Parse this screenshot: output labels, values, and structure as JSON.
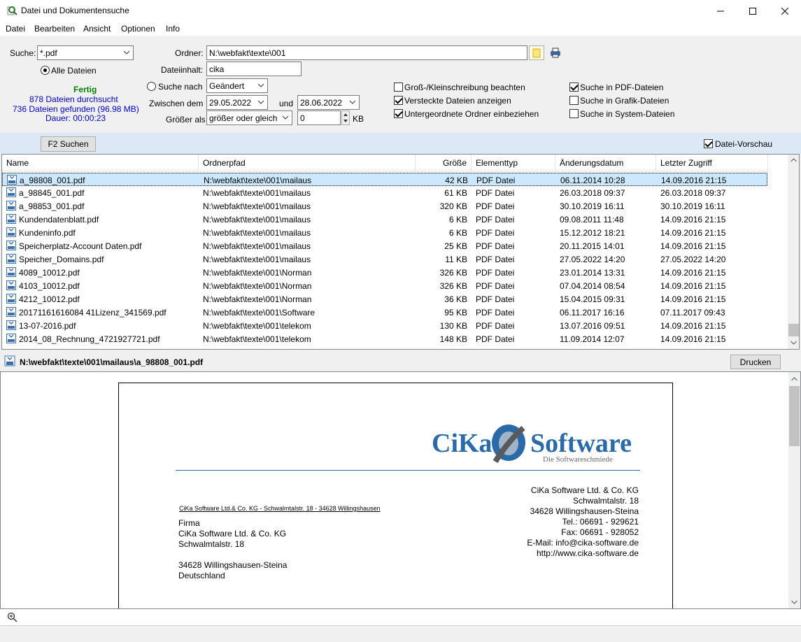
{
  "window": {
    "title": "Datei und Dokumentensuche"
  },
  "menu": [
    "Datei",
    "Bearbeiten",
    "Ansicht",
    "Optionen",
    "Info"
  ],
  "search": {
    "suche_label": "Suche:",
    "suche_value": "*.pdf",
    "alle_dateien_label": "Alle Dateien",
    "ordner_label": "Ordner:",
    "ordner_value": "N:\\webfakt\\texte\\001",
    "dateiinhalt_label": "Dateiinhalt:",
    "dateiinhalt_value": "cika",
    "suche_nach_label": "Suche nach",
    "suche_nach_value": "Geändert",
    "zwischen_label": "Zwischen dem",
    "date_from": "29.05.2022",
    "und_label": "und",
    "date_to": "28.06.2022",
    "groesser_label": "Größer als",
    "groesser_value": "größer oder gleich",
    "size_value": "0",
    "kb_label": "KB"
  },
  "status": {
    "state": "Fertig",
    "scanned": "878 Dateien durchsucht",
    "found": "736 Dateien gefunden (96.98 MB)",
    "duration": "Dauer: 00:00:23"
  },
  "options": {
    "case": "Groß-/Kleinschreibung beachten",
    "hidden": "Versteckte Dateien anzeigen",
    "subfolders": "Untergeordnete Ordner einbeziehen",
    "pdf": "Suche in PDF-Dateien",
    "graphics": "Suche in Grafik-Dateien",
    "system": "Suche in System-Dateien",
    "preview": "Datei-Vorschau"
  },
  "toolbar": {
    "search_button": "F2  Suchen"
  },
  "columns": [
    "Name",
    "Ordnerpfad",
    "Größe",
    "Elementtyp",
    "Änderungsdatum",
    "Letzter Zugriff"
  ],
  "files": [
    {
      "name": "a_98808_001.pdf",
      "path": "N:\\webfakt\\texte\\001\\mailaus",
      "size": "42 KB",
      "type": "PDF Datei",
      "modified": "06.11.2014 10:28",
      "accessed": "14.09.2016 21:15"
    },
    {
      "name": "a_98845_001.pdf",
      "path": "N:\\webfakt\\texte\\001\\mailaus",
      "size": "61 KB",
      "type": "PDF Datei",
      "modified": "26.03.2018 09:37",
      "accessed": "26.03.2018 09:37"
    },
    {
      "name": "a_98853_001.pdf",
      "path": "N:\\webfakt\\texte\\001\\mailaus",
      "size": "320 KB",
      "type": "PDF Datei",
      "modified": "30.10.2019 16:11",
      "accessed": "30.10.2019 16:11"
    },
    {
      "name": "Kundendatenblatt.pdf",
      "path": "N:\\webfakt\\texte\\001\\mailaus",
      "size": "6 KB",
      "type": "PDF Datei",
      "modified": "09.08.2011 11:48",
      "accessed": "14.09.2016 21:15"
    },
    {
      "name": "Kundeninfo.pdf",
      "path": "N:\\webfakt\\texte\\001\\mailaus",
      "size": "6 KB",
      "type": "PDF Datei",
      "modified": "15.12.2012 18:21",
      "accessed": "14.09.2016 21:15"
    },
    {
      "name": "Speicherplatz-Account Daten.pdf",
      "path": "N:\\webfakt\\texte\\001\\mailaus",
      "size": "25 KB",
      "type": "PDF Datei",
      "modified": "20.11.2015 14:01",
      "accessed": "14.09.2016 21:15"
    },
    {
      "name": "Speicher_Domains.pdf",
      "path": "N:\\webfakt\\texte\\001\\mailaus",
      "size": "11 KB",
      "type": "PDF Datei",
      "modified": "27.05.2022 14:20",
      "accessed": "27.05.2022 14:20"
    },
    {
      "name": "4089_10012.pdf",
      "path": "N:\\webfakt\\texte\\001\\Norman",
      "size": "326 KB",
      "type": "PDF Datei",
      "modified": "23.01.2014 13:31",
      "accessed": "14.09.2016 21:15"
    },
    {
      "name": "4103_10012.pdf",
      "path": "N:\\webfakt\\texte\\001\\Norman",
      "size": "326 KB",
      "type": "PDF Datei",
      "modified": "07.04.2014 08:54",
      "accessed": "14.09.2016 21:15"
    },
    {
      "name": "4212_10012.pdf",
      "path": "N:\\webfakt\\texte\\001\\Norman",
      "size": "36 KB",
      "type": "PDF Datei",
      "modified": "15.04.2015 09:31",
      "accessed": "14.09.2016 21:15"
    },
    {
      "name": "20171161616084 41Lizenz_341569.pdf",
      "path": "N:\\webfakt\\texte\\001\\Software",
      "size": "95 KB",
      "type": "PDF Datei",
      "modified": "06.11.2017 16:16",
      "accessed": "07.11.2017 09:43"
    },
    {
      "name": "13-07-2016.pdf",
      "path": "N:\\webfakt\\texte\\001\\telekom",
      "size": "130 KB",
      "type": "PDF Datei",
      "modified": "13.07.2016 09:51",
      "accessed": "14.09.2016 21:15"
    },
    {
      "name": "2014_08_Rechnung_4721927721.pdf",
      "path": "N:\\webfakt\\texte\\001\\telekom",
      "size": "148 KB",
      "type": "PDF Datei",
      "modified": "11.09.2014 12:07",
      "accessed": "14.09.2016 21:15"
    }
  ],
  "preview": {
    "path": "N:\\webfakt\\texte\\001\\mailaus\\a_98808_001.pdf",
    "print_button": "Drucken",
    "logo_text": "CiKa Software",
    "logo_tagline": "Die Softwareschmiede",
    "sender_line": "CiKa Software Ltd.& Co. KG - Schwalmtalstr. 18 - 34628 Willingshausen",
    "address": [
      "Firma",
      "CiKa Software Ltd. & Co. KG",
      "Schwalmtalstr. 18",
      "",
      "34628 Willingshausen-Steina",
      "Deutschland"
    ],
    "company": [
      "CiKa Software Ltd. & Co. KG",
      "Schwalmtalstr. 18",
      "34628 Willingshausen-Steina",
      "Tel.: 06691 - 929621",
      "Fax: 06691 - 928052",
      "E-Mail: info@cika-software.de",
      "http://www.cika-software.de"
    ]
  },
  "colors": {
    "status_green": "#008000",
    "status_blue": "#0000cc",
    "selection": "#cce8ff",
    "logo_blue": "#2a6aa8"
  }
}
